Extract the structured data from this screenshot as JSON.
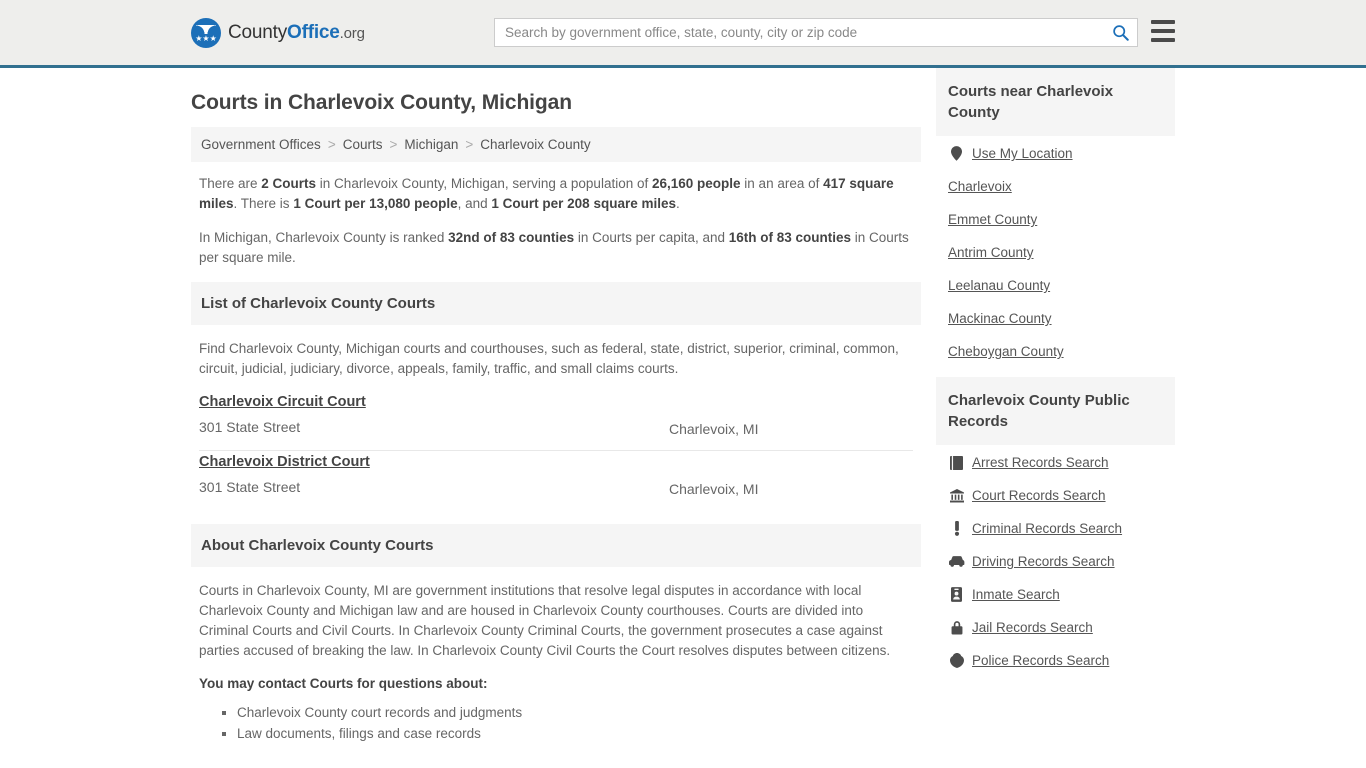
{
  "header": {
    "brand": {
      "part1": "County",
      "part2": "Office",
      "part3": ".org"
    },
    "search": {
      "placeholder": "Search by government office, state, county, city or zip code",
      "value": ""
    },
    "search_icon": "search-icon",
    "menu_icon": "hamburger-menu-icon"
  },
  "page": {
    "title": "Courts in Charlevoix County, Michigan",
    "breadcrumb": [
      "Government Offices",
      "Courts",
      "Michigan",
      "Charlevoix County"
    ],
    "breadcrumb_separator": ">"
  },
  "stats": {
    "para1": [
      {
        "t": "There are ",
        "b": false
      },
      {
        "t": "2 Courts",
        "b": true
      },
      {
        "t": " in Charlevoix County, Michigan, serving a population of ",
        "b": false
      },
      {
        "t": "26,160 people",
        "b": true
      },
      {
        "t": " in an area of ",
        "b": false
      },
      {
        "t": "417 square miles",
        "b": true
      },
      {
        "t": ". There is ",
        "b": false
      },
      {
        "t": "1 Court per 13,080 people",
        "b": true
      },
      {
        "t": ", and ",
        "b": false
      },
      {
        "t": "1 Court per 208 square miles",
        "b": true
      },
      {
        "t": ".",
        "b": false
      }
    ],
    "para2": [
      {
        "t": "In Michigan, Charlevoix County is ranked ",
        "b": false
      },
      {
        "t": "32nd of 83 counties",
        "b": true
      },
      {
        "t": " in Courts per capita, and ",
        "b": false
      },
      {
        "t": "16th of 83 counties",
        "b": true
      },
      {
        "t": " in Courts per square mile.",
        "b": false
      }
    ]
  },
  "list_section": {
    "heading": "List of Charlevoix County Courts",
    "description": "Find Charlevoix County, Michigan courts and courthouses, such as federal, state, district, superior, criminal, common, circuit, judicial, judiciary, divorce, appeals, family, traffic, and small claims courts.",
    "courts": [
      {
        "name": "Charlevoix Circuit Court",
        "address": "301 State Street",
        "city": "Charlevoix, MI"
      },
      {
        "name": "Charlevoix District Court",
        "address": "301 State Street",
        "city": "Charlevoix, MI"
      }
    ]
  },
  "about_section": {
    "heading": "About Charlevoix County Courts",
    "body": "Courts in Charlevoix County, MI are government institutions that resolve legal disputes in accordance with local Charlevoix County and Michigan law and are housed in Charlevoix County courthouses. Courts are divided into Criminal Courts and Civil Courts. In Charlevoix County Criminal Courts, the government prosecutes a case against parties accused of breaking the law. In Charlevoix County Civil Courts the Court resolves disputes between citizens.",
    "contact_lead": "You may contact Courts for questions about:",
    "contact_items": [
      "Charlevoix County court records and judgments",
      "Law documents, filings and case records"
    ]
  },
  "sidebar": {
    "nearby": {
      "heading": "Courts near Charlevoix County",
      "items": [
        {
          "label": "Use My Location",
          "icon": "map-pin-icon",
          "glyph": "•"
        },
        {
          "label": "Charlevoix",
          "icon": "",
          "glyph": ""
        },
        {
          "label": "Emmet County",
          "icon": "",
          "glyph": ""
        },
        {
          "label": "Antrim County",
          "icon": "",
          "glyph": ""
        },
        {
          "label": "Leelanau County",
          "icon": "",
          "glyph": ""
        },
        {
          "label": "Mackinac County",
          "icon": "",
          "glyph": ""
        },
        {
          "label": "Cheboygan County",
          "icon": "",
          "glyph": ""
        }
      ]
    },
    "public_records": {
      "heading": "Charlevoix County Public Records",
      "items": [
        {
          "label": "Arrest Records Search",
          "icon": "book-icon"
        },
        {
          "label": "Court Records Search",
          "icon": "courthouse-icon"
        },
        {
          "label": "Criminal Records Search",
          "icon": "exclamation-icon"
        },
        {
          "label": "Driving Records Search",
          "icon": "car-icon"
        },
        {
          "label": "Inmate Search",
          "icon": "id-badge-icon"
        },
        {
          "label": "Jail Records Search",
          "icon": "padlock-icon"
        },
        {
          "label": "Police Records Search",
          "icon": "police-badge-icon"
        }
      ]
    }
  },
  "colors": {
    "brand_blue": "#1c6fb8",
    "header_bg": "#eeeeec",
    "header_rule": "#31708f",
    "panel_bg": "#f5f5f5",
    "text": "#666666",
    "heading_text": "#444444"
  }
}
